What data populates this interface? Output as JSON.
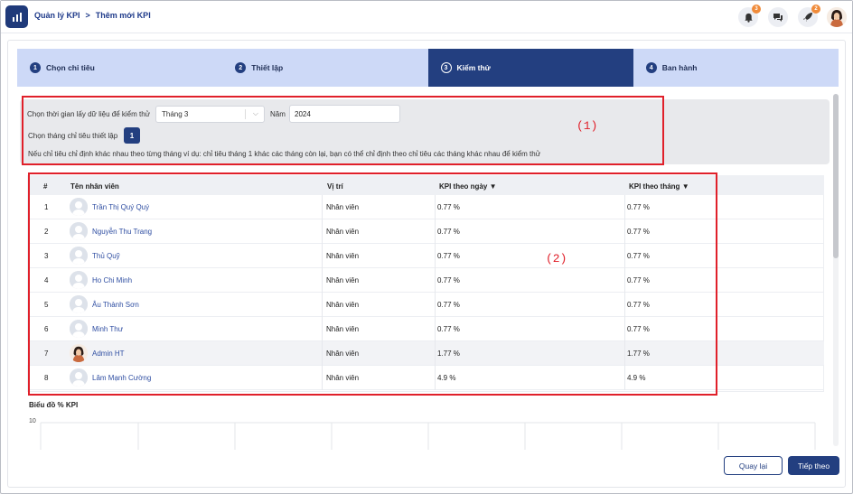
{
  "breadcrumb": {
    "parent": "Quản lý KPI",
    "separator": ">",
    "current": "Thêm mới KPI"
  },
  "header": {
    "notifications_count": "3",
    "rocket_count": "2"
  },
  "stepper": [
    {
      "num": "1",
      "label": "Chọn chỉ tiêu",
      "active": false
    },
    {
      "num": "2",
      "label": "Thiết lập",
      "active": false
    },
    {
      "num": "3",
      "label": "Kiểm thử",
      "active": true
    },
    {
      "num": "4",
      "label": "Ban hành",
      "active": false
    }
  ],
  "filter": {
    "time_label": "Chọn thời gian lấy dữ liệu để kiểm thử",
    "month_value": "Tháng 3",
    "year_label": "Năm",
    "year_value": "2024",
    "month_setup_label": "Chọn tháng chỉ tiêu thiết lập",
    "month_setup_value": "1",
    "note": "Nếu chỉ tiêu chỉ định khác nhau theo từng tháng ví dụ: chỉ tiêu tháng 1 khác các tháng còn lại, bạn có thể chỉ định theo chỉ tiêu các tháng khác nhau để kiểm thử"
  },
  "annotations": {
    "box1": "(1)",
    "box2": "(2)"
  },
  "table": {
    "headers": {
      "index": "#",
      "name": "Tên nhân viên",
      "position": "Vị trí",
      "kpi_day": "KPI theo ngày",
      "kpi_month": "KPI theo tháng"
    },
    "rows": [
      {
        "index": "1",
        "name": "Trần Thị Quý Quý",
        "position": "Nhân viên",
        "kpi_day": "0.77 %",
        "kpi_month": "0.77 %",
        "avatar": "default"
      },
      {
        "index": "2",
        "name": "Nguyễn Thu Trang",
        "position": "Nhân viên",
        "kpi_day": "0.77 %",
        "kpi_month": "0.77 %",
        "avatar": "default"
      },
      {
        "index": "3",
        "name": "Thủ Quỹ",
        "position": "Nhân viên",
        "kpi_day": "0.77 %",
        "kpi_month": "0.77 %",
        "avatar": "default"
      },
      {
        "index": "4",
        "name": "Ho Chi Minh",
        "position": "Nhân viên",
        "kpi_day": "0.77 %",
        "kpi_month": "0.77 %",
        "avatar": "default"
      },
      {
        "index": "5",
        "name": "Âu Thành Sơn",
        "position": "Nhân viên",
        "kpi_day": "0.77 %",
        "kpi_month": "0.77 %",
        "avatar": "default"
      },
      {
        "index": "6",
        "name": "Minh Thư",
        "position": "Nhân viên",
        "kpi_day": "0.77 %",
        "kpi_month": "0.77 %",
        "avatar": "default"
      },
      {
        "index": "7",
        "name": "Admin HT",
        "position": "Nhân viên",
        "kpi_day": "1.77 %",
        "kpi_month": "1.77 %",
        "avatar": "photo"
      },
      {
        "index": "8",
        "name": "Lâm Mạnh Cường",
        "position": "Nhân viên",
        "kpi_day": "4.9 %",
        "kpi_month": "4.9 %",
        "avatar": "default"
      }
    ]
  },
  "chart": {
    "title": "Biểu đồ % KPI",
    "y_tick_top": "10"
  },
  "footer": {
    "back_label": "Quay lại",
    "next_label": "Tiếp theo"
  },
  "colors": {
    "primary": "#233f80",
    "step_bg": "#cdd9f7",
    "highlight_red": "#e0202a",
    "link": "#2f4ea2"
  }
}
